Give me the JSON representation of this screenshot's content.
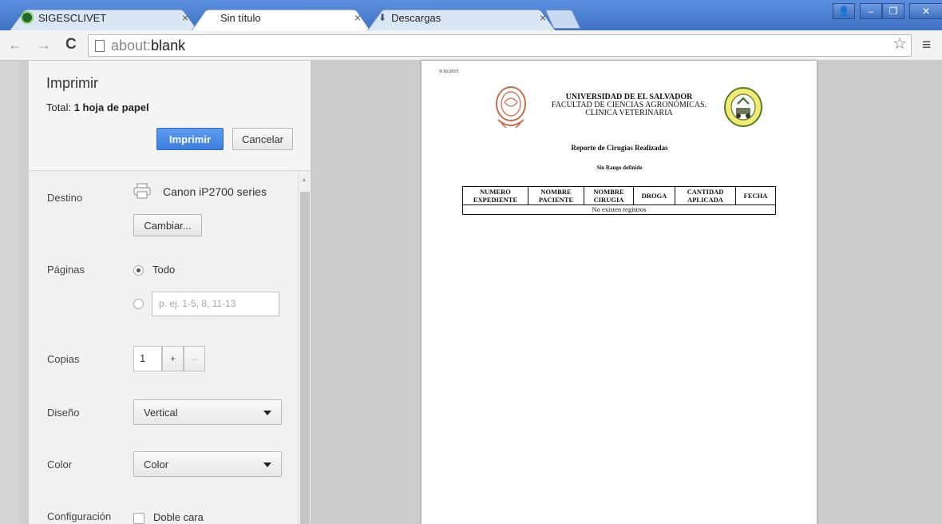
{
  "browser": {
    "tabs": [
      {
        "label": "SIGESCLIVET",
        "active": false
      },
      {
        "label": "Sin título",
        "active": true
      },
      {
        "label": "Descargas",
        "active": false
      }
    ],
    "url_scheme": "about:",
    "url_path": "blank"
  },
  "print_dialog": {
    "title": "Imprimir",
    "total_prefix": "Total: ",
    "total_value": "1 hoja de papel",
    "print_button": "Imprimir",
    "cancel_button": "Cancelar",
    "destination": {
      "label": "Destino",
      "printer": "Canon iP2700 series",
      "change_button": "Cambiar..."
    },
    "pages": {
      "label": "Páginas",
      "option_all": "Todo",
      "range_placeholder": "p. ej. 1-5, 8, 11-13",
      "selected": "Todo"
    },
    "copies": {
      "label": "Copias",
      "value": "1",
      "plus": "+",
      "minus": "–"
    },
    "layout": {
      "label": "Diseño",
      "value": "Vertical"
    },
    "color": {
      "label": "Color",
      "value": "Color"
    },
    "options": {
      "label": "Configuración",
      "duplex_label": "Doble cara",
      "duplex_checked": false
    }
  },
  "preview": {
    "date": "9/10/2015",
    "header_line1": "UNIVERSIDAD DE EL SALVADOR",
    "header_line2": "FACULTAD DE CIENCIAS AGRONÓMICAS.",
    "header_line3": "CLINICA VETERINARIA",
    "report_title": "Reporte de Cirugias Realizadas",
    "report_subtitle": "Sin Rango definido",
    "table": {
      "columns": [
        [
          "NUMERO",
          "EXPEDIENTE"
        ],
        [
          "NOMBRE",
          "PACIENTE"
        ],
        [
          "NOMBRE",
          "CIRUGIA"
        ],
        [
          "DROGA"
        ],
        [
          "CANTIDAD",
          "APLICADA"
        ],
        [
          "FECHA"
        ]
      ],
      "empty_message": "No existen registros"
    }
  },
  "colors": {
    "titlebar": "#3f72c4",
    "print_button": "#3c7ee0",
    "preview_background": "#cccccc"
  }
}
